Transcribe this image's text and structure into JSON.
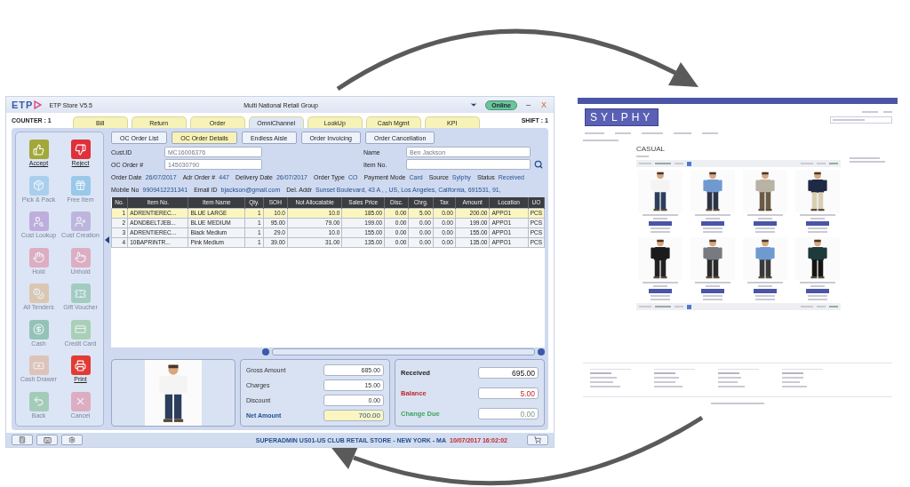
{
  "left_app": {
    "title_bar": {
      "logo": "ETP",
      "app_name": "ETP Store V5.5",
      "company": "Multi National Retail Group",
      "status_badge": "Online",
      "minimize": "–",
      "close": "X"
    },
    "counter": "COUNTER : 1",
    "shift": "SHIFT : 1",
    "tabs": [
      {
        "label": "Bill",
        "selected": false
      },
      {
        "label": "Return",
        "selected": false
      },
      {
        "label": "Order",
        "selected": false
      },
      {
        "label": "OmniChannel",
        "selected": true
      },
      {
        "label": "LookUp",
        "selected": false
      },
      {
        "label": "Cash Mgmt",
        "selected": false
      },
      {
        "label": "KPI",
        "selected": false
      }
    ],
    "actions": [
      {
        "label": "Accept",
        "disabled": false
      },
      {
        "label": "Reject",
        "disabled": false
      },
      {
        "label": "Pick & Pack",
        "disabled": true
      },
      {
        "label": "Free Item",
        "disabled": true
      },
      {
        "label": "Cust Lookup",
        "disabled": true
      },
      {
        "label": "Cust Creation",
        "disabled": true
      },
      {
        "label": "Hold",
        "disabled": true
      },
      {
        "label": "Unhold",
        "disabled": true
      },
      {
        "label": "All Tenders",
        "disabled": true
      },
      {
        "label": "Gift Voucher",
        "disabled": true
      },
      {
        "label": "Cash",
        "disabled": true
      },
      {
        "label": "Credit Card",
        "disabled": true
      },
      {
        "label": "Cash Drawer",
        "disabled": true
      },
      {
        "label": "Print",
        "disabled": false
      },
      {
        "label": "Back",
        "disabled": true
      },
      {
        "label": "Cancel",
        "disabled": true
      }
    ],
    "subtabs": [
      {
        "label": "OC Order List",
        "selected": false
      },
      {
        "label": "OC Order Details",
        "selected": true
      },
      {
        "label": "Endless Aisle",
        "selected": false
      },
      {
        "label": "Order Invoicing",
        "selected": false
      },
      {
        "label": "Order Cancellation",
        "selected": false
      }
    ],
    "form": {
      "cust_id": {
        "label": "Cust.ID",
        "value": "MC16006376"
      },
      "oc_order": {
        "label": "OC Order #",
        "value": "145030790"
      },
      "name": {
        "label": "Name",
        "value": "Ben Jackson"
      },
      "item_no": {
        "label": "Item No."
      }
    },
    "info_rows": [
      [
        {
          "label": "Order Date",
          "value": "26/07/2017"
        },
        {
          "label": "Adr Order #",
          "value": "447"
        },
        {
          "label": "Delivery Date",
          "value": "26/07/2017"
        },
        {
          "label": "Order Type",
          "value": "CO"
        },
        {
          "label": "Payment Mode",
          "value": "Card"
        },
        {
          "label": "Source",
          "value": "Sylphy"
        },
        {
          "label": "Status",
          "value": "Received"
        }
      ],
      [
        {
          "label": "Mobile No",
          "value": "9909412231341"
        },
        {
          "label": "Email ID",
          "value": "bjackson@gmail.com"
        },
        {
          "label": "Del. Addr",
          "value": "Sunset Boulevard, 43 A , , US, Los Angeles, California, 691531, 91,"
        }
      ]
    ],
    "table": {
      "columns": [
        "No.",
        "Item No.",
        "Item Name",
        "Qty.",
        "SOH",
        "Not Allocatable",
        "Sales Price",
        "Disc.",
        "Chrg.",
        "Tax",
        "Amount",
        "Location",
        "UO"
      ],
      "rows": [
        {
          "selected": true,
          "cells": [
            "1",
            "ADRENTIEREC...",
            "BLUE LARGE",
            "1",
            "10.0",
            "10.0",
            "185.00",
            "0.00",
            "5.00",
            "0.00",
            "200.00",
            "APPO1",
            "PCS"
          ]
        },
        {
          "selected": false,
          "cells": [
            "2",
            "ADNDBELTJEB...",
            "BLUE MEDIUM",
            "1",
            "95.00",
            "79.00",
            "199.00",
            "0.00",
            "0.00",
            "0.00",
            "199.00",
            "APPO1",
            "PCS"
          ]
        },
        {
          "selected": false,
          "cells": [
            "3",
            "ADRENTIEREC...",
            "Black Medium",
            "1",
            "29.0",
            "10.0",
            "155.00",
            "0.00",
            "0.00",
            "0.00",
            "155.00",
            "APPO1",
            "PCS"
          ]
        },
        {
          "selected": false,
          "cells": [
            "4",
            "10BAPRINTR...",
            "Pink Medium",
            "1",
            "39.00",
            "31.00",
            "135.00",
            "0.00",
            "0.00",
            "0.00",
            "135.00",
            "APPO1",
            "PCS"
          ]
        }
      ]
    },
    "totals": [
      {
        "label": "Gross Amount",
        "value": "685.00",
        "kind": "plain"
      },
      {
        "label": "Charges",
        "value": "15.00",
        "kind": "plain"
      },
      {
        "label": "Discount",
        "value": "0.00",
        "kind": "plain"
      },
      {
        "label": "Net Amount",
        "value": "700.00",
        "kind": "net"
      }
    ],
    "payment": [
      {
        "label": "Received",
        "value": "695.00",
        "kind": "received"
      },
      {
        "label": "Balance",
        "value": "5.00",
        "kind": "balance"
      },
      {
        "label": "Change Due",
        "value": "0.00",
        "kind": "change"
      }
    ],
    "status_bar": {
      "user_store": "SUPERADMIN  US01-US CLUB RETAIL STORE - NEW YORK - MA",
      "datetime": "10/07/2017 16:02:02"
    }
  },
  "web_store": {
    "logo": "SYLPHY",
    "heading": "CASUAL",
    "products": [
      {
        "kind": "product"
      },
      {
        "kind": "product"
      },
      {
        "kind": "product"
      },
      {
        "kind": "product"
      },
      {
        "kind": "product"
      },
      {
        "kind": "product"
      },
      {
        "kind": "product"
      },
      {
        "kind": "product"
      }
    ],
    "footer": [
      {
        "kind": "link_column"
      },
      {
        "kind": "link_column"
      },
      {
        "kind": "link_column"
      },
      {
        "kind": "link_column"
      }
    ]
  }
}
